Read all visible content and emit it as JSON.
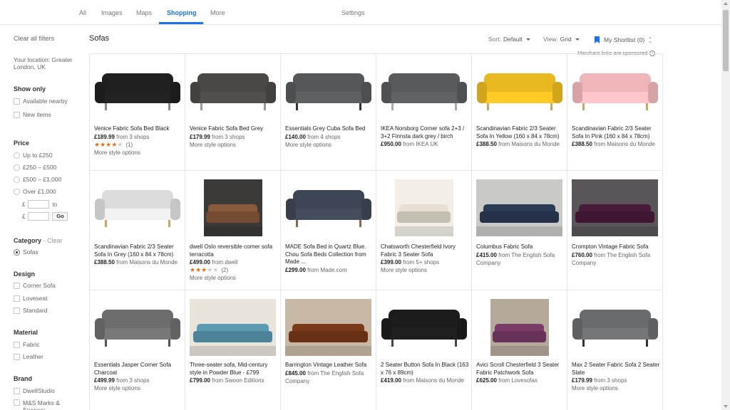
{
  "tabs": [
    {
      "label": "All"
    },
    {
      "label": "Images"
    },
    {
      "label": "Maps"
    },
    {
      "label": "Shopping"
    },
    {
      "label": "More"
    },
    {
      "label": "Settings"
    }
  ],
  "sidebar": {
    "clear_filters": "Clear all filters",
    "location": "Your location: Greater London, UK",
    "show_only": {
      "heading": "Show only",
      "options": [
        "Available nearby",
        "New items"
      ]
    },
    "price": {
      "heading": "Price",
      "options": [
        "Up to £250",
        "£250 – £500",
        "£500 – £1,000",
        "Over £1,000"
      ],
      "currency": "£",
      "to": "to",
      "go": "Go"
    },
    "category": {
      "heading": "Category",
      "clear": "- Clear",
      "selected": "Sofas"
    },
    "design": {
      "heading": "Design",
      "options": [
        "Corner Sofa",
        "Loveseat",
        "Standard"
      ]
    },
    "material": {
      "heading": "Material",
      "options": [
        "Fabric",
        "Leather"
      ]
    },
    "brand": {
      "heading": "Brand",
      "options": [
        "DwellStudio",
        "M&S Marks & Spencer"
      ]
    }
  },
  "results": {
    "title": "Sofas",
    "sort_label": "Sort:",
    "sort_value": "Default",
    "view_label": "View:",
    "view_value": "Grid",
    "shortlist": "My Shortlist (0)",
    "sponsored": "Merchant links are sponsored"
  },
  "colors": {
    "accent": "#1a73e8",
    "star": "#e7711b"
  },
  "products": [
    {
      "name": "Venice Fabric Sofa Bed Black",
      "price": "£189.99",
      "source": "from 3 shops",
      "rating": "(1)",
      "stars": 4,
      "more": "More style options",
      "color": "#1f1f1f",
      "legs": "#888",
      "photo": false
    },
    {
      "name": "Venice Fabric Sofa Bed Grey",
      "price": "£179.99",
      "source": "from 3 shops",
      "more": "More style options",
      "color": "#4a4745",
      "legs": "#999",
      "photo": false
    },
    {
      "name": "Essentials Grey Cuba Sofa Bed",
      "price": "£140.00",
      "source": "from 4 shops",
      "more": "More style options",
      "color": "#555758",
      "legs": "#333",
      "photo": false
    },
    {
      "name": "IKEA Norsborg Corner sofa 2+3 / 3+2 Finnsta dark grey / birch",
      "price": "£950.00",
      "source": "from IKEA UK",
      "color": "#58595b",
      "legs": "#aaa",
      "photo": false
    },
    {
      "name": "Scandinavian Fabric 2/3 Seater Sofa In Yellow (160 x 84 x 78cm)",
      "price": "£388.50",
      "source": "from Maisons du Monde",
      "color": "#e8b820",
      "legs": "#c9a76a",
      "photo": false
    },
    {
      "name": "Scandinavian Fabric 2/3 Seater Sofa In Pink (160 x 84 x 78cm)",
      "price": "£388.50",
      "source": "from Maisons du Monde",
      "color": "#f0b5b9",
      "legs": "#c9a76a",
      "photo": false
    },
    {
      "name": "Scandinavian Fabric 2/3 Seater Sofa In Grey (160 x 84 x 78cm)",
      "price": "£388.50",
      "source": "from Maisons du Monde",
      "color": "#dcdcdc",
      "legs": "#c9a76a",
      "photo": false
    },
    {
      "name": "dwell Oslo reversible corner sofa terracotta",
      "price": "£499.00",
      "source": "from dwell",
      "rating": "(2)",
      "stars": 3,
      "more": "More style options",
      "color": "#8a5a3a",
      "bg": "#3b3a38",
      "photo": true
    },
    {
      "name": "MADE Sofa Bed in Quartz Blue. Chou Sofa Beds Collection from Made ...",
      "price": "£299.00",
      "source": "from Made.com",
      "color": "#3d4654",
      "legs": "#8a6a4a",
      "photo": false
    },
    {
      "name": "Chatsworth Chesterfield Ivory Fabric 3 Seater Sofa",
      "price": "£399.00",
      "source": "from 5+ shops",
      "more": "More style options",
      "color": "#e8e1d3",
      "bg": "#f3efe8",
      "photo": true
    },
    {
      "name": "Columbus Fabric Sofa",
      "price": "£415.00",
      "source": "from The English Sofa Company",
      "color": "#2a3a55",
      "bg": "#c9c9c6",
      "photo": true
    },
    {
      "name": "Crompton Vintage Fabric Sofa",
      "price": "£760.00",
      "source": "from The English Sofa Company",
      "color": "#4a1a3a",
      "bg": "#5a5558",
      "photo": true
    },
    {
      "name": "Essentials Jasper Corner Sofa Charcoal",
      "price": "£499.99",
      "source": "from 3 shops",
      "more": "More style options",
      "color": "#6d6d6d",
      "legs": "#555",
      "photo": false
    },
    {
      "name": "Three-seater sofa, Mid-century style in Powder Blue - £799",
      "price": "£799.00",
      "source": "from Swoon Editions",
      "color": "#5b9ab3",
      "bg": "#e9e4dc",
      "photo": true
    },
    {
      "name": "Barrington Vintage Leather Sofa",
      "price": "£845.00",
      "source": "from The English Sofa Company",
      "color": "#7a3a1a",
      "bg": "#c8b9a6",
      "photo": true
    },
    {
      "name": "2 Seater Button Sofa In Black (163 x 76 x 89cm)",
      "price": "£419.00",
      "source": "from Maisons du Monde",
      "color": "#1c1c1c",
      "legs": "#444",
      "photo": false
    },
    {
      "name": "Avici Scroll Chesterfield 3 Seater Fabric Patchwork Sofa",
      "price": "£625.00",
      "source": "from Lovesofas",
      "color": "#7a3a6a",
      "bg": "#b5a99a",
      "photo": true
    },
    {
      "name": "Max 2 Seater Fabric Sofa 2 Seater Slate",
      "price": "£179.99",
      "source": "from 3 shops",
      "more": "More style options",
      "color": "#6a6b6d",
      "legs": "#333",
      "photo": false
    }
  ]
}
